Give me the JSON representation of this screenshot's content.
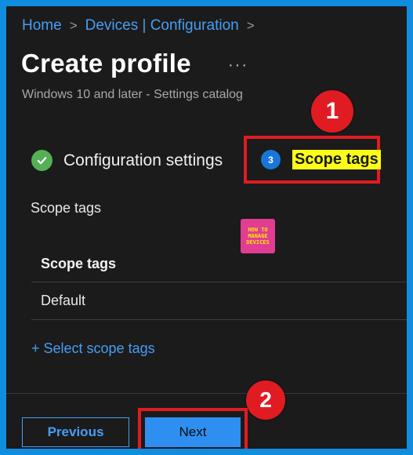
{
  "breadcrumb": {
    "home": "Home",
    "devices": "Devices | Configuration",
    "separator": ">"
  },
  "header": {
    "title": "Create profile",
    "more": "···",
    "subtitle": "Windows 10 and later - Settings catalog"
  },
  "steps": [
    {
      "label": "Configuration settings",
      "state": "completed",
      "icon": "check-icon"
    },
    {
      "label": "Scope tags",
      "number": "3",
      "state": "current"
    }
  ],
  "content": {
    "section_label": "Scope tags",
    "logo_lines": [
      "HOW TO",
      "MANAGE",
      "DEVICES"
    ],
    "table": {
      "header": "Scope tags",
      "rows": [
        "Default"
      ]
    },
    "select_link": "+ Select scope tags"
  },
  "footer": {
    "previous_label": "Previous",
    "next_label": "Next"
  },
  "annotations": {
    "marker1": "1",
    "marker2": "2"
  },
  "colors": {
    "accent": "#479ef5",
    "annotation_red": "#e11b22",
    "highlight": "#fdfd1a",
    "success": "#54b054"
  }
}
